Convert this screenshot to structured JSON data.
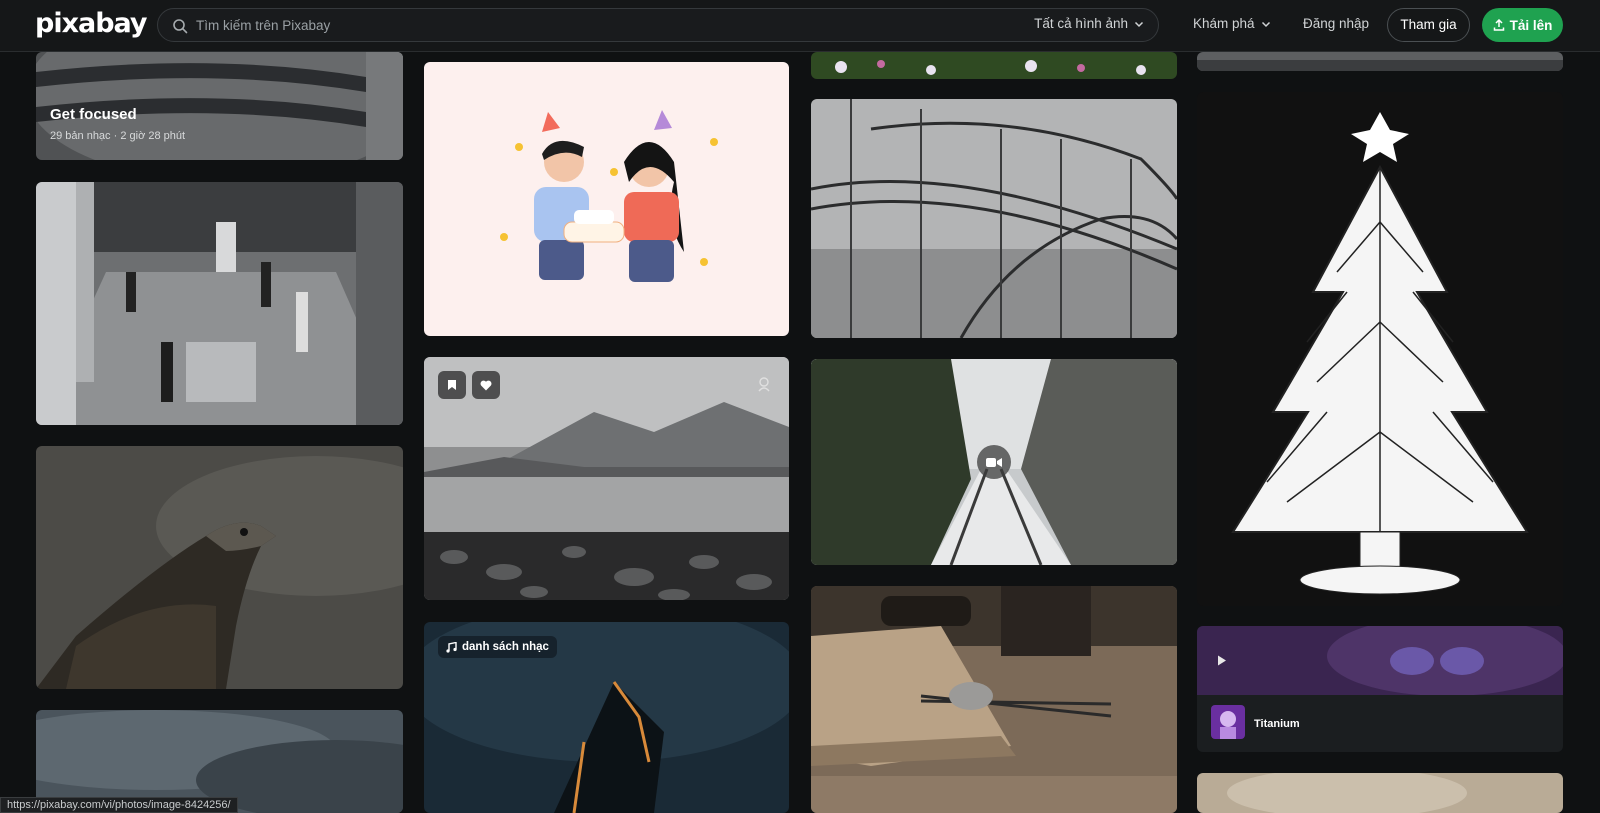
{
  "header": {
    "logo": "pixabay",
    "search_placeholder": "Tìm kiếm trên Pixabay",
    "filter_label": "Tất cả hình ảnh",
    "explore_label": "Khám phá",
    "login_label": "Đăng nhập",
    "join_label": "Tham gia",
    "upload_label": "Tải lên"
  },
  "cards": {
    "playlist_focus": {
      "title": "Get focused",
      "subtitle": "29 bản nhạc  ·  2 giờ 28 phút"
    },
    "music_playlist_badge": "danh sách nhạc",
    "music_track": {
      "title": "Titanium"
    }
  },
  "status_bar": {
    "url": "https://pixabay.com/vi/photos/image-8424256/"
  },
  "colors": {
    "brand_green": "#1fa250",
    "background": "#0f1112",
    "header": "#151718"
  },
  "icons": [
    "search-icon",
    "chevron-down-icon",
    "upload-icon",
    "bookmark-icon",
    "heart-icon",
    "ai-badge-icon",
    "video-camera-icon",
    "music-note-icon",
    "play-icon"
  ]
}
